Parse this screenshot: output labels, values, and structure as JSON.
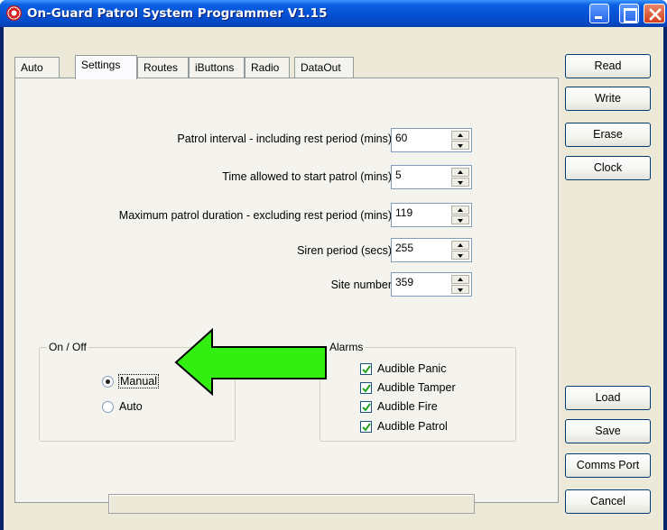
{
  "window": {
    "title": "On-Guard Patrol System Programmer V1.15"
  },
  "tabs": [
    {
      "label": "Auto",
      "active": false
    },
    {
      "label": "Settings",
      "active": true
    },
    {
      "label": "Routes",
      "active": false
    },
    {
      "label": "iButtons",
      "active": false
    },
    {
      "label": "Radio",
      "active": false
    },
    {
      "label": "DataOut",
      "active": false
    }
  ],
  "settings": {
    "patrol_interval": {
      "label": "Patrol interval - including rest period (mins)",
      "value": "60"
    },
    "start_time": {
      "label": "Time allowed to start patrol (mins)",
      "value": "5"
    },
    "max_duration": {
      "label": "Maximum patrol duration - excluding rest period (mins)",
      "value": "119"
    },
    "siren_period": {
      "label": "Siren period (secs)",
      "value": "255"
    },
    "site_number": {
      "label": "Site number",
      "value": "359"
    }
  },
  "onoff": {
    "title": "On / Off",
    "options": [
      {
        "label": "Manual",
        "selected": true
      },
      {
        "label": "Auto",
        "selected": false
      }
    ]
  },
  "alarms": {
    "title": "Alarms",
    "items": [
      {
        "label": "Audible Panic",
        "checked": true
      },
      {
        "label": "Audible Tamper",
        "checked": true
      },
      {
        "label": "Audible Fire",
        "checked": true
      },
      {
        "label": "Audible Patrol",
        "checked": true
      }
    ]
  },
  "buttons": {
    "read": "Read",
    "write": "Write",
    "erase": "Erase",
    "clock": "Clock",
    "load": "Load",
    "save": "Save",
    "comms_port": "Comms Port",
    "cancel": "Cancel"
  },
  "progress": {
    "value": 0
  },
  "colors": {
    "titlebar": "#0553d6",
    "client_bg": "#ece9d8",
    "arrow_fill": "#33ee11",
    "arrow_stroke": "#000000"
  },
  "icons": {
    "app": "app-logo-icon",
    "minimize": "minimize-icon",
    "maximize": "maximize-icon",
    "close": "close-icon",
    "arrow": "left-arrow-icon"
  }
}
